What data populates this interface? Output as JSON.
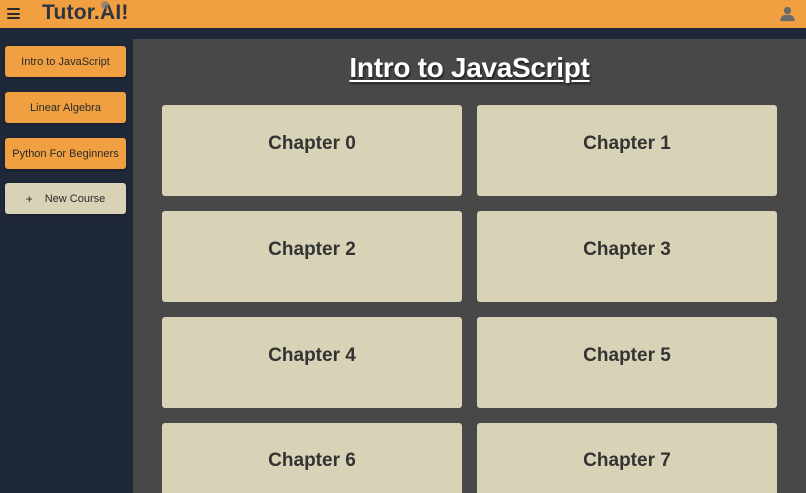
{
  "header": {
    "brand": "Tutor.AI!",
    "menu_icon": "hamburger-menu-icon",
    "user_icon": "user-account-icon",
    "bar_color": "#f0a040"
  },
  "sidebar": {
    "courses": [
      {
        "label": "Intro to JavaScript"
      },
      {
        "label": "Linear Algebra"
      },
      {
        "label": "Python For Beginners"
      }
    ],
    "new_course": {
      "icon": "+",
      "label": "New Course"
    }
  },
  "main": {
    "title": "Intro to JavaScript",
    "chapters": [
      {
        "label": "Chapter 0"
      },
      {
        "label": "Chapter 1"
      },
      {
        "label": "Chapter 2"
      },
      {
        "label": "Chapter 3"
      },
      {
        "label": "Chapter 4"
      },
      {
        "label": "Chapter 5"
      },
      {
        "label": "Chapter 6"
      },
      {
        "label": "Chapter 7"
      }
    ]
  },
  "colors": {
    "accent": "#f0a040",
    "sidebar_bg": "#1f2838",
    "content_bg": "#484848",
    "card_bg": "#d8d2b6"
  }
}
